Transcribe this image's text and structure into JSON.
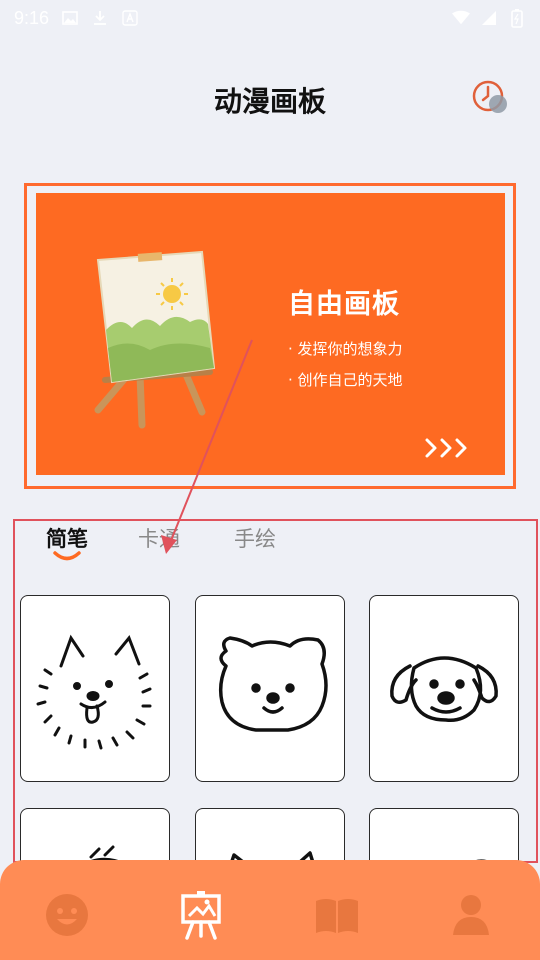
{
  "status_bar": {
    "time": "9:16",
    "icons": [
      "image-icon",
      "download-icon",
      "a-icon",
      "wifi-icon",
      "signal-icon",
      "battery-icon"
    ]
  },
  "header": {
    "title": "动漫画板",
    "history_icon": "clock-icon"
  },
  "banner": {
    "title": "自由画板",
    "lines": [
      "· 发挥你的想象力",
      "· 创作自己的天地"
    ],
    "more_icon": "chevrons-right-icon"
  },
  "tabs": [
    {
      "label": "简笔",
      "active": true
    },
    {
      "label": "卡通",
      "active": false
    },
    {
      "label": "手绘",
      "active": false
    }
  ],
  "cards": [
    {
      "name": "pomeranian-drawing"
    },
    {
      "name": "bear-dog-drawing"
    },
    {
      "name": "puppy-drawing"
    },
    {
      "name": "drawing-4"
    },
    {
      "name": "cat-drawing"
    },
    {
      "name": "drawing-6"
    }
  ],
  "bottom_nav": [
    {
      "icon": "smiley-icon",
      "active": false
    },
    {
      "icon": "easel-icon",
      "active": true
    },
    {
      "icon": "book-icon",
      "active": false
    },
    {
      "icon": "person-icon",
      "active": false
    }
  ],
  "colors": {
    "accent": "#fe6a22",
    "nav_background": "#ff8c55",
    "page_background": "#eef0f6",
    "annotation": "#e0525c"
  }
}
